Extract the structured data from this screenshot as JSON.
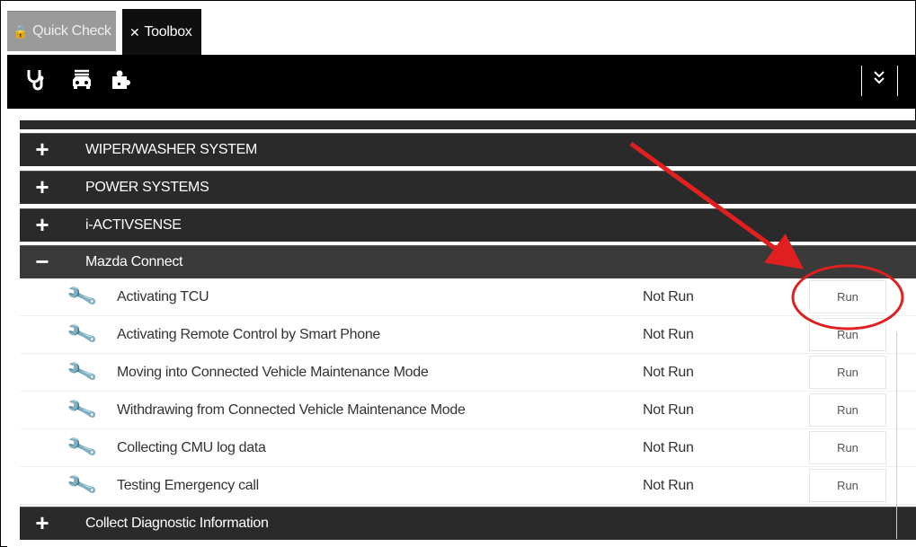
{
  "tabs": [
    {
      "label": "Quick Check",
      "icon": "lock-icon"
    },
    {
      "label": "Toolbox",
      "icon": "tools-icon",
      "active": true
    }
  ],
  "toolbar": {
    "icons": [
      "stethoscope-icon",
      "vehicle-icon",
      "puzzle-icon"
    ],
    "chevron": "»"
  },
  "categories": [
    {
      "label": "WIPER/WASHER SYSTEM",
      "toggle": "+"
    },
    {
      "label": "POWER SYSTEMS",
      "toggle": "+"
    },
    {
      "label": "i-ACTIVSENSE",
      "toggle": "+"
    },
    {
      "label": "Mazda Connect",
      "toggle": "−",
      "expanded": true
    }
  ],
  "procedures": [
    {
      "label": "Activating TCU",
      "status": "Not Run",
      "button": "Run"
    },
    {
      "label": "Activating Remote Control by Smart Phone",
      "status": "Not Run",
      "button": "Run"
    },
    {
      "label": "Moving into Connected Vehicle Maintenance Mode",
      "status": "Not Run",
      "button": "Run"
    },
    {
      "label": "Withdrawing from Connected Vehicle Maintenance Mode",
      "status": "Not Run",
      "button": "Run"
    },
    {
      "label": "Collecting CMU log data",
      "status": "Not Run",
      "button": "Run"
    },
    {
      "label": "Testing Emergency call",
      "status": "Not Run",
      "button": "Run"
    }
  ],
  "bottom_category": {
    "label": "Collect Diagnostic Information",
    "toggle": "+"
  },
  "colors": {
    "annotation": "#e02020",
    "toolbar": "#000000",
    "category_row": "#2a2a2a"
  }
}
